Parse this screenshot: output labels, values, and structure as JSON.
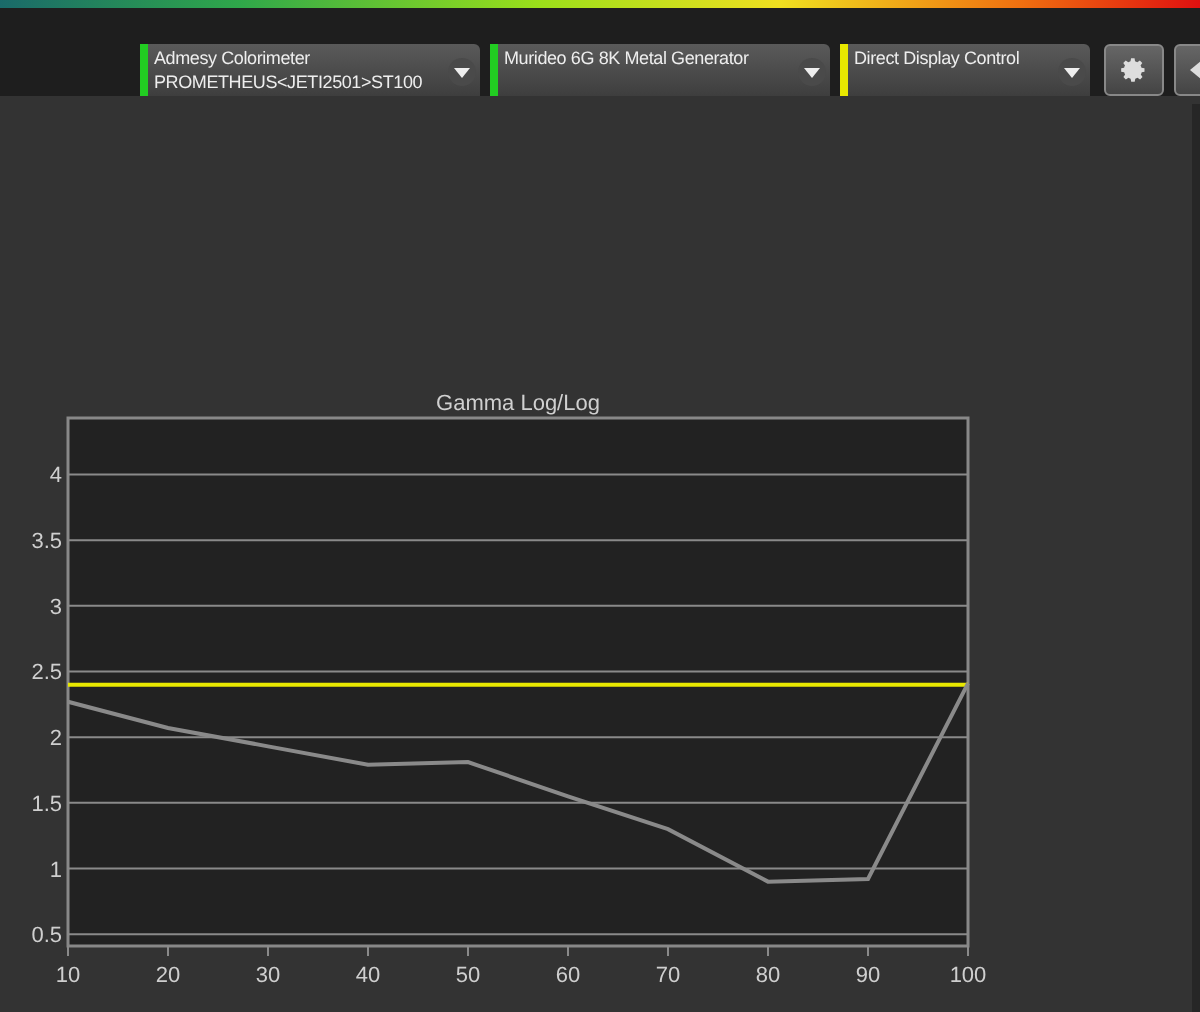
{
  "devices": [
    {
      "label": "Admesy Colorimeter",
      "detail": "PROMETHEUS<JETI2501>ST100",
      "color": "#22cc22"
    },
    {
      "label": "Murideo 6G 8K Metal Generator",
      "color": "#22cc22"
    },
    {
      "label": "Direct Display Control",
      "color": "#e8e800"
    }
  ],
  "chart": {
    "chart_data": {
      "type": "line",
      "title": "Gamma Log/Log",
      "x": [
        10,
        20,
        30,
        40,
        50,
        60,
        70,
        80,
        90,
        100
      ],
      "series": [
        {
          "color": "#e8e800",
          "values": [
            2.4,
            2.4,
            2.4,
            2.4,
            2.4,
            2.4,
            2.4,
            2.4,
            2.4,
            2.4
          ]
        },
        {
          "color": "#8a8a8a",
          "values": [
            2.27,
            2.07,
            1.93,
            1.79,
            1.81,
            1.55,
            1.3,
            0.9,
            0.92,
            2.41
          ]
        }
      ],
      "xlim": [
        10,
        100
      ],
      "ylim": [
        0.41,
        4.43
      ],
      "xticks": [
        10,
        20,
        30,
        40,
        50,
        60,
        70,
        80,
        90,
        100
      ],
      "yticks": [
        0.5,
        1,
        1.5,
        2,
        2.5,
        3,
        3.5,
        4
      ]
    }
  }
}
